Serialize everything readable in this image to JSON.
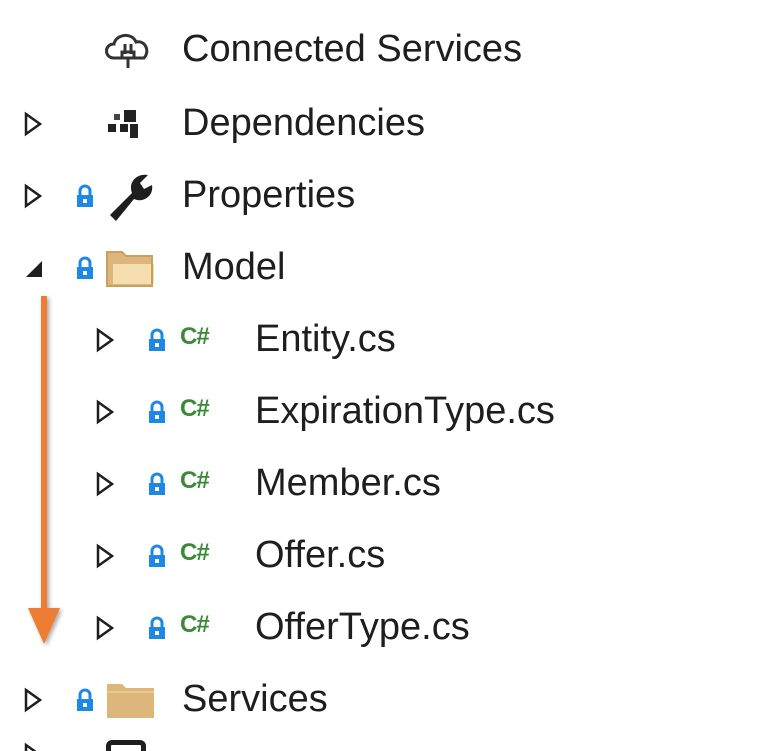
{
  "tree": {
    "items": [
      {
        "label": "Connected Services",
        "icon": "connected-services-icon",
        "expand": "none",
        "lock": false
      },
      {
        "label": "Dependencies",
        "icon": "dependencies-icon",
        "expand": "collapsed",
        "lock": false
      },
      {
        "label": "Properties",
        "icon": "wrench-icon",
        "expand": "collapsed",
        "lock": true
      },
      {
        "label": "Model",
        "icon": "folder-open-icon",
        "expand": "expanded",
        "lock": true
      },
      {
        "label": "Entity.cs",
        "icon": "csharp-file-icon",
        "expand": "collapsed",
        "lock": true
      },
      {
        "label": "ExpirationType.cs",
        "icon": "csharp-file-icon",
        "expand": "collapsed",
        "lock": true
      },
      {
        "label": "Member.cs",
        "icon": "csharp-file-icon",
        "expand": "collapsed",
        "lock": true
      },
      {
        "label": "Offer.cs",
        "icon": "csharp-file-icon",
        "expand": "collapsed",
        "lock": true
      },
      {
        "label": "OfferType.cs",
        "icon": "csharp-file-icon",
        "expand": "collapsed",
        "lock": true
      },
      {
        "label": "Services",
        "icon": "folder-icon",
        "expand": "collapsed",
        "lock": true
      }
    ],
    "csharp_glyph": "C#"
  },
  "colors": {
    "accent_arrow": "#ed7d31",
    "lock": "#1e88e5",
    "csharp": "#388a34",
    "folder": "#dcb67a"
  }
}
